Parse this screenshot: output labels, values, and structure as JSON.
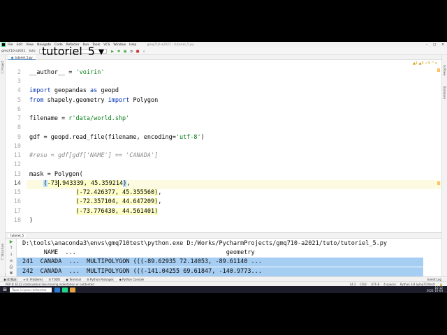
{
  "menubar": {
    "items": [
      "File",
      "Edit",
      "View",
      "Navigate",
      "Code",
      "Refactor",
      "Run",
      "Tools",
      "VCS",
      "Window",
      "Help"
    ],
    "window_title": "gmq710-a2021 - tutoriel_5.py",
    "controls": [
      "–",
      "□",
      "✕"
    ]
  },
  "toolbar": {
    "breadcrumbs": [
      "gmq710-a2021",
      "tuto",
      "tutoriel_5.py"
    ],
    "run_config": "tutoriel_5 ▾"
  },
  "filetab": {
    "label": "tutoriel_5.py"
  },
  "left_strip": {
    "project_label": "1: Project",
    "structure_label": "7: Structure",
    "favorites_label": "2: Favorites"
  },
  "right_strip": {
    "scview_label": "SciView",
    "database_label": "Database"
  },
  "editor": {
    "line_numbers": [
      "2",
      "3",
      "4",
      "5",
      "6",
      "7",
      "8",
      "9",
      "10",
      "11",
      "12",
      "13",
      "14",
      "15",
      "16",
      "17",
      "18"
    ],
    "current_line": "14",
    "warnings": "▲1 ▲5 ✓3 ^ v",
    "lines": {
      "l2": {
        "a": "__author__ = ",
        "b": "'voirin'"
      },
      "l4": {
        "a": "import",
        "b": " geopandas ",
        "c": "as",
        "d": " geopd"
      },
      "l5": {
        "a": "from",
        "b": " shapely.geometry ",
        "c": "import",
        "d": " Polygon"
      },
      "l7": {
        "a": "filename = ",
        "b": "r'data/world.shp'"
      },
      "l9": {
        "a": "gdf = geopd.read_file(filename, encoding=",
        "b": "'utf-8'",
        "c": ")"
      },
      "l11": {
        "a": "#resu = gdf[gdf['NAME'] == 'CANADA']"
      },
      "l13": {
        "a": "mask = Polygon("
      },
      "l14": {
        "a": "(",
        "b": "-73",
        "c": ".943339, 45.359214",
        "d": ")",
        "e": ","
      },
      "l15": {
        "a": "(-72.426377, 45.355560)",
        "b": ","
      },
      "l16": {
        "a": "(-72.357104, 44.647209)",
        "b": ","
      },
      "l17": {
        "a": "(-73.776430, 44.561401)"
      },
      "l18": {
        "a": ")"
      }
    }
  },
  "run_panel": {
    "tab_label": "tutoriel_5",
    "command": "D:\\tools\\anaconda3\\envs\\gmq710test\\python.exe D:/Works/PycharmProjects/gmq710-a2021/tuto/tutoriel_5.py",
    "header_row": "      NAME  ...                                          geometry",
    "rows": [
      "241  CANADA  ...  MULTIPOLYGON (((-89.62935 72.14053, -89.61140 ...",
      "242  CANADA  ...  MULTIPOLYGON (((-141.04255 69.61847, -140.9773..."
    ]
  },
  "tool_strip": {
    "items": [
      "▶ 4: Run",
      "≡ 6: Problems",
      "☰ TODO",
      "▣ Terminal",
      "⚙ Python Packages",
      "◆ Python Console"
    ],
    "event_log": "Event Log"
  },
  "statusbar": {
    "message": "PEP 8: E122 continuation line missing indentation or outdented",
    "position": "14:3",
    "line_sep": "CRLF",
    "encoding": "UTF-8",
    "indent": "4 spaces",
    "interpreter": "Python 3.8 (gmq710test)"
  },
  "taskbar": {
    "search_placeholder": "Taper ici pour rechercher",
    "time": "10:12",
    "date": "2021-10-04"
  },
  "colors": {
    "keyword": "#0033b3",
    "string": "#067d17",
    "comment": "#8c8c8c",
    "selection": "#a6cdf2",
    "current_line": "#fcfae1"
  }
}
